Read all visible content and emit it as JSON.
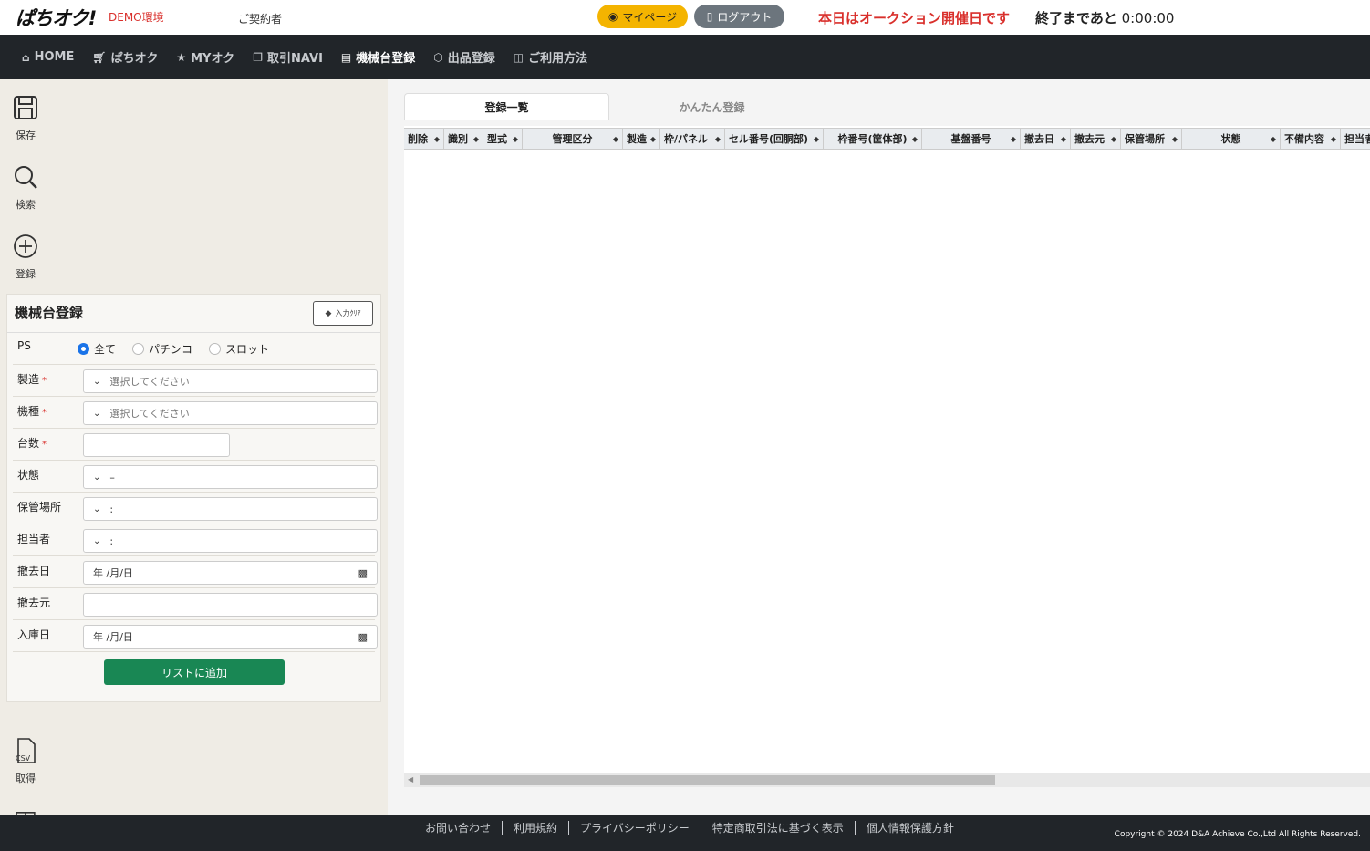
{
  "header": {
    "logo": "ぱちオク!",
    "env": "DEMO環境",
    "contractor": "ご契約者",
    "mypage_label": "マイページ",
    "logout_label": "ログアウト",
    "auction_message": "本日はオークション開催日です",
    "countdown_prefix": "終了まであと",
    "countdown_time": "0:00:00"
  },
  "nav": {
    "items": [
      {
        "label": "HOME",
        "icon": "home-icon"
      },
      {
        "label": "ぱちオク",
        "icon": "cart-icon"
      },
      {
        "label": "MYオク",
        "icon": "star-icon"
      },
      {
        "label": "取引NAVI",
        "icon": "copy-icon"
      },
      {
        "label": "機械台登録",
        "icon": "file-icon"
      },
      {
        "label": "出品登録",
        "icon": "box-icon"
      },
      {
        "label": "ご利用方法",
        "icon": "book-icon"
      }
    ]
  },
  "sidebar": {
    "tools": [
      {
        "label": "保存",
        "icon": "save-icon"
      },
      {
        "label": "検索",
        "icon": "search-icon"
      },
      {
        "label": "登録",
        "icon": "plus-circle-icon"
      },
      {
        "label": "取得",
        "icon": "csv-file-icon"
      }
    ],
    "csv_text": "CSV"
  },
  "form": {
    "title": "機械台登録",
    "clear_label": "入力ｸﾘｱ",
    "ps_label": "PS",
    "ps_options": [
      "全て",
      "パチンコ",
      "スロット"
    ],
    "maker_label": "製造",
    "maker_placeholder": "選択してください",
    "model_label": "機種",
    "model_placeholder": "選択してください",
    "count_label": "台数",
    "count_value": "",
    "status_label": "状態",
    "status_value": "–",
    "storage_label": "保管場所",
    "storage_value": ":",
    "person_label": "担当者",
    "person_value": ":",
    "removal_date_label": "撤去日",
    "removal_date_value": "年 /月/日",
    "removal_src_label": "撤去元",
    "removal_src_value": "",
    "stock_date_label": "入庫日",
    "stock_date_value": "年 /月/日",
    "required_mark": "*",
    "add_button": "リストに追加"
  },
  "main": {
    "tabs": [
      "登録一覧",
      "かんたん登録"
    ],
    "columns": [
      "削除",
      "識別",
      "型式",
      "管理区分",
      "製造",
      "枠/パネル",
      "セル番号(回胴部)",
      "枠番号(筐体部)",
      "基盤番号",
      "撤去日",
      "撤去元",
      "保管場所",
      "状態",
      "不備内容",
      "担当者"
    ]
  },
  "footer": {
    "links": [
      "お問い合わせ",
      "利用規約",
      "プライバシーポリシー",
      "特定商取引法に基づく表示",
      "個人情報保護方針"
    ],
    "copyright": "Copyright © 2024 D&A Achieve Co.,Ltd All Rights Reserved."
  },
  "colors": {
    "nav_bg": "#212529",
    "accent_yellow": "#f4b400",
    "alert_red": "#d9302c",
    "add_green": "#198754",
    "sidebar_bg": "#efece5"
  }
}
